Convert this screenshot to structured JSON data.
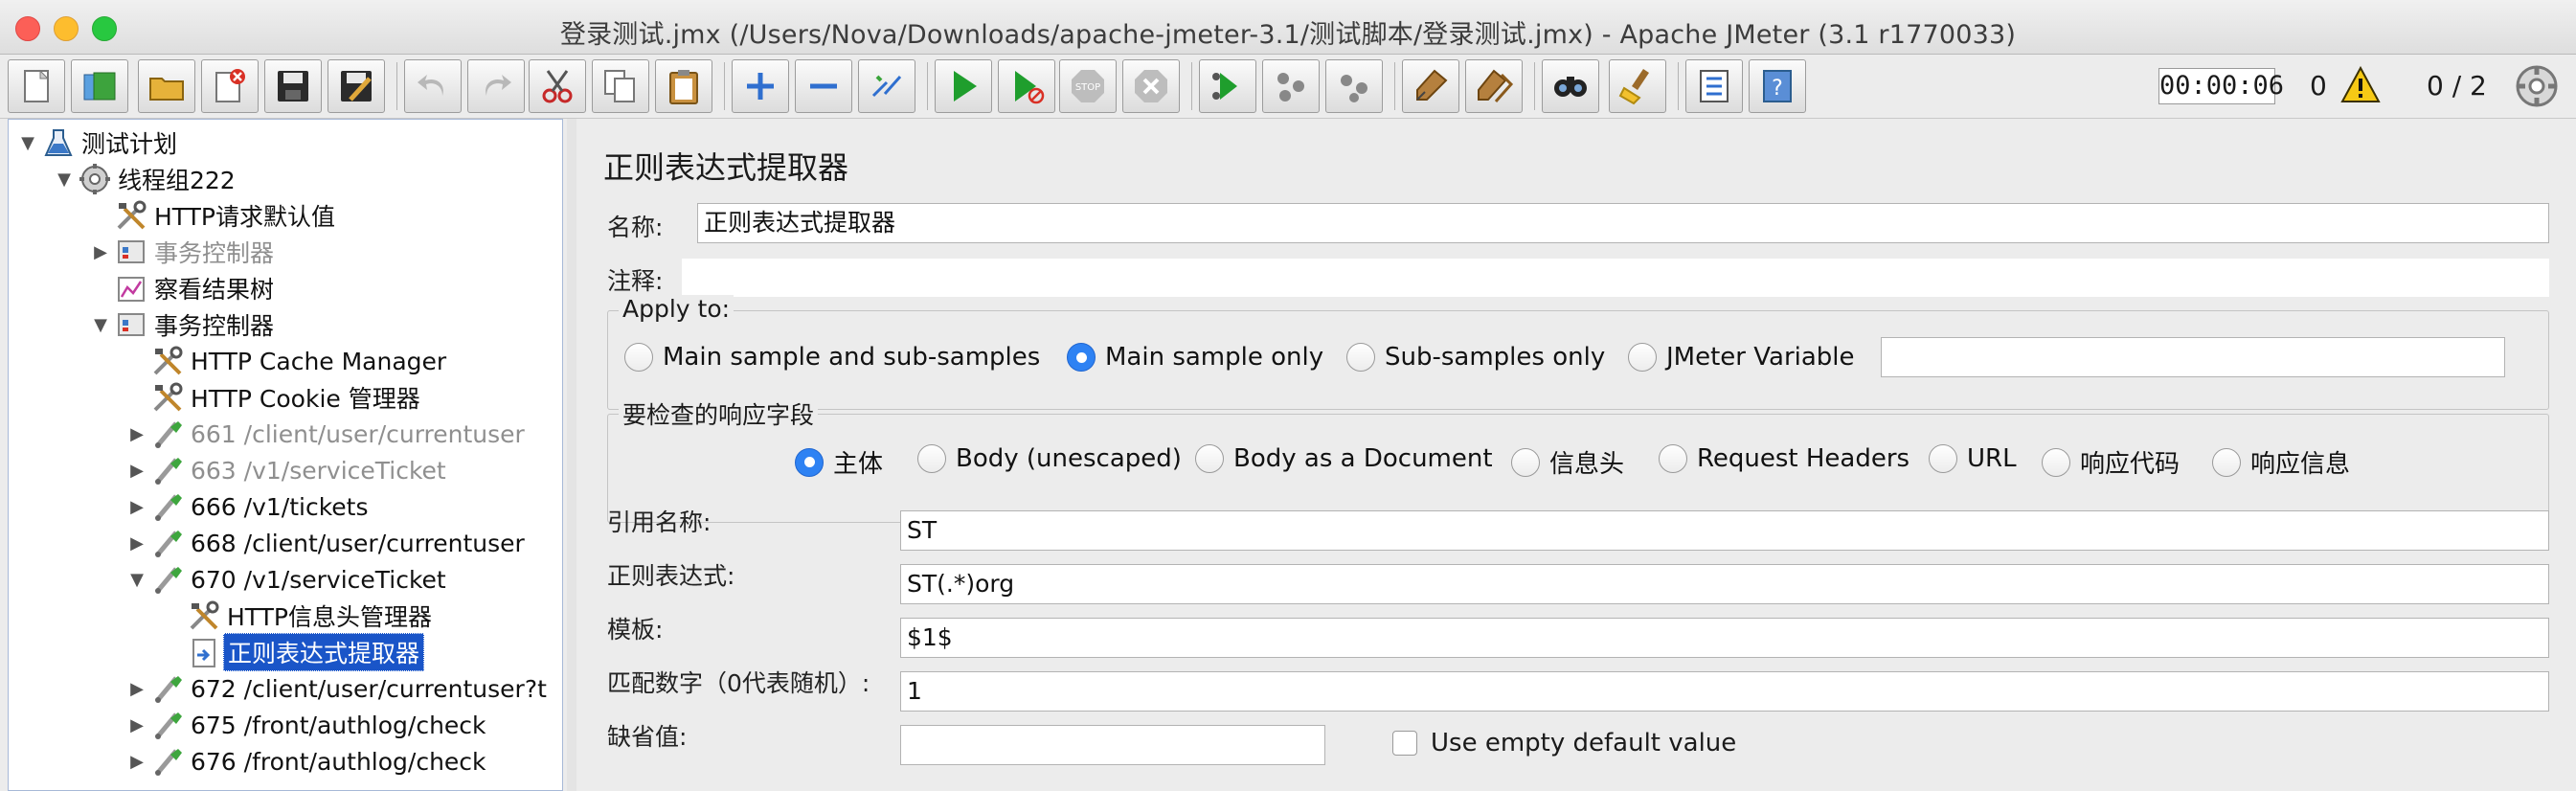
{
  "window": {
    "title": "登录测试.jmx (/Users/Nova/Downloads/apache-jmeter-3.1/测试脚本/登录测试.jmx) - Apache JMeter (3.1 r1770033)"
  },
  "toolbar": {
    "icons": [
      "new-icon",
      "templates-icon",
      "open-icon",
      "close-icon",
      "save-icon",
      "save-as-icon",
      "undo-icon",
      "redo-icon",
      "cut-icon",
      "copy-icon",
      "paste-icon",
      "expand-icon",
      "collapse-icon",
      "toggle-icon",
      "start-icon",
      "start-no-pause-icon",
      "stop-icon",
      "shutdown-icon",
      "remote-start-icon",
      "remote-stop-icon",
      "remote-shutdown-icon",
      "clear-icon",
      "clear-all-icon",
      "search-icon",
      "reset-search-icon",
      "function-helper-icon",
      "help-icon"
    ],
    "timer": "00:00:06",
    "error_count": "0",
    "threads": "0 / 2"
  },
  "tree": {
    "nodes": [
      {
        "label": "测试计划",
        "icon": "test-plan-icon",
        "depth": 0,
        "arrow": "down",
        "state": "normal"
      },
      {
        "label": "线程组222",
        "icon": "thread-group-icon",
        "depth": 1,
        "arrow": "down",
        "state": "normal"
      },
      {
        "label": "HTTP请求默认值",
        "icon": "config-tools-icon",
        "depth": 2,
        "arrow": "",
        "state": "normal"
      },
      {
        "label": "事务控制器",
        "icon": "controller-icon",
        "depth": 2,
        "arrow": "right",
        "state": "disabled"
      },
      {
        "label": "察看结果树",
        "icon": "listener-icon",
        "depth": 2,
        "arrow": "",
        "state": "normal"
      },
      {
        "label": "事务控制器",
        "icon": "controller-icon",
        "depth": 2,
        "arrow": "down",
        "state": "normal"
      },
      {
        "label": "HTTP Cache Manager",
        "icon": "config-tools-icon",
        "depth": 3,
        "arrow": "",
        "state": "normal"
      },
      {
        "label": "HTTP Cookie 管理器",
        "icon": "config-tools-icon",
        "depth": 3,
        "arrow": "",
        "state": "normal"
      },
      {
        "label": "661 /client/user/currentuser",
        "icon": "sampler-icon",
        "depth": 3,
        "arrow": "right",
        "state": "disabled"
      },
      {
        "label": "663 /v1/serviceTicket",
        "icon": "sampler-icon",
        "depth": 3,
        "arrow": "right",
        "state": "disabled"
      },
      {
        "label": "666 /v1/tickets",
        "icon": "sampler-icon",
        "depth": 3,
        "arrow": "right",
        "state": "normal"
      },
      {
        "label": "668 /client/user/currentuser",
        "icon": "sampler-icon",
        "depth": 3,
        "arrow": "right",
        "state": "normal"
      },
      {
        "label": "670 /v1/serviceTicket",
        "icon": "sampler-icon",
        "depth": 3,
        "arrow": "down",
        "state": "normal"
      },
      {
        "label": "HTTP信息头管理器",
        "icon": "config-tools-icon",
        "depth": 4,
        "arrow": "",
        "state": "normal"
      },
      {
        "label": "正则表达式提取器",
        "icon": "extractor-icon",
        "depth": 4,
        "arrow": "",
        "state": "selected"
      },
      {
        "label": "672 /client/user/currentuser?t",
        "icon": "sampler-icon",
        "depth": 3,
        "arrow": "right",
        "state": "normal"
      },
      {
        "label": "675 /front/authlog/check",
        "icon": "sampler-icon",
        "depth": 3,
        "arrow": "right",
        "state": "normal"
      },
      {
        "label": "676 /front/authlog/check",
        "icon": "sampler-icon",
        "depth": 3,
        "arrow": "right",
        "state": "normal"
      }
    ]
  },
  "panel": {
    "title": "正则表达式提取器",
    "name_label": "名称:",
    "name_value": "正则表达式提取器",
    "comment_label": "注释:",
    "comment_value": "",
    "apply_to": {
      "title": "Apply to:",
      "options": [
        "Main sample and sub-samples",
        "Main sample only",
        "Sub-samples only",
        "JMeter Variable"
      ],
      "selected": "Main sample only",
      "variable_value": ""
    },
    "field_to_check": {
      "title": "要检查的响应字段",
      "options": [
        "主体",
        "Body (unescaped)",
        "Body as a Document",
        "信息头",
        "Request Headers",
        "URL",
        "响应代码",
        "响应信息"
      ],
      "selected": "主体"
    },
    "ref_name_label": "引用名称:",
    "ref_name_value": "ST",
    "regex_label": "正则表达式:",
    "regex_value": "ST(.*)org",
    "template_label": "模板:",
    "template_value": "$1$",
    "match_no_label": "匹配数字（0代表随机）:",
    "match_no_value": "1",
    "default_label": "缺省值:",
    "default_value": "",
    "use_empty_default_label": "Use empty default value"
  },
  "colors": {
    "selection": "#1a55c8",
    "radio_selected": "#2e82f3",
    "start_green": "#1f9e2d"
  }
}
